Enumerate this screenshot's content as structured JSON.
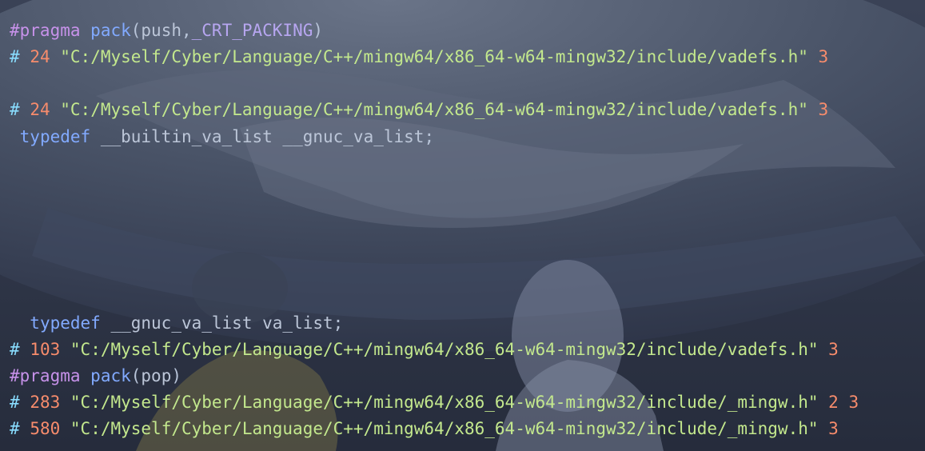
{
  "editor": {
    "lines": {
      "l1": {
        "directive": "#pragma",
        "func": "pack",
        "open": "(",
        "arg1": "push",
        "comma": ",",
        "arg2": "_CRT_PACKING",
        "close": ")"
      },
      "l2": {
        "hash": "#",
        "num": "24",
        "path": "\"C:/Myself/Cyber/Language/C++/mingw64/x86_64-w64-mingw32/include/vadefs.h\"",
        "flag": "3"
      },
      "l3": {
        "hash": "#",
        "num": "24",
        "path": "\"C:/Myself/Cyber/Language/C++/mingw64/x86_64-w64-mingw32/include/vadefs.h\"",
        "flag": "3"
      },
      "l4": {
        "kw": "typedef",
        "t1": "__builtin_va_list",
        "t2": "__gnuc_va_list",
        "semi": ";"
      },
      "l5": {
        "kw": "typedef",
        "t1": "__gnuc_va_list",
        "t2": "va_list",
        "semi": ";"
      },
      "l6": {
        "hash": "#",
        "num": "103",
        "path": "\"C:/Myself/Cyber/Language/C++/mingw64/x86_64-w64-mingw32/include/vadefs.h\"",
        "flag": "3"
      },
      "l7": {
        "directive": "#pragma",
        "func": "pack",
        "open": "(",
        "arg1": "pop",
        "close": ")"
      },
      "l8": {
        "hash": "#",
        "num": "283",
        "path": "\"C:/Myself/Cyber/Language/C++/mingw64/x86_64-w64-mingw32/include/_mingw.h\"",
        "flag": "2 3"
      },
      "l9": {
        "hash": "#",
        "num": "580",
        "path": "\"C:/Myself/Cyber/Language/C++/mingw64/x86_64-w64-mingw32/include/_mingw.h\"",
        "flag": "3"
      }
    }
  },
  "colors": {
    "background": "#2a3142",
    "keyword": "#c792ea",
    "number": "#f78c6c",
    "string": "#c3e88d",
    "identifier": "#bcc6d8"
  }
}
